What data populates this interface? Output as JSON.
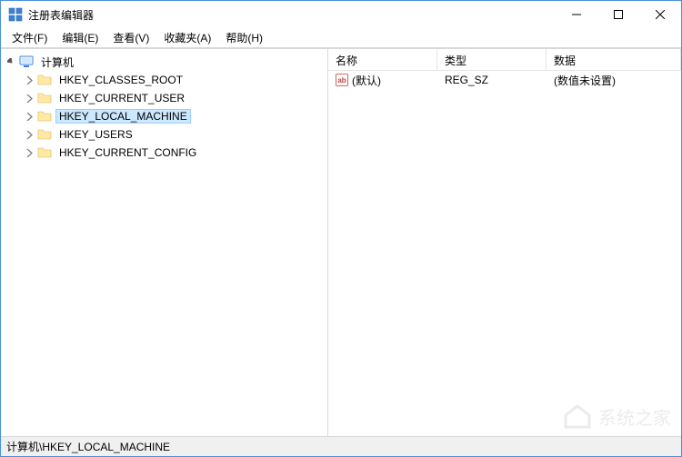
{
  "window": {
    "title": "注册表编辑器"
  },
  "menu": {
    "file": "文件(F)",
    "edit": "编辑(E)",
    "view": "查看(V)",
    "favorites": "收藏夹(A)",
    "help": "帮助(H)"
  },
  "tree": {
    "root_label": "计算机",
    "items": [
      {
        "label": "HKEY_CLASSES_ROOT"
      },
      {
        "label": "HKEY_CURRENT_USER"
      },
      {
        "label": "HKEY_LOCAL_MACHINE"
      },
      {
        "label": "HKEY_USERS"
      },
      {
        "label": "HKEY_CURRENT_CONFIG"
      }
    ],
    "selected_index": 2
  },
  "list": {
    "columns": {
      "name": "名称",
      "type": "类型",
      "data": "数据"
    },
    "rows": [
      {
        "name": "(默认)",
        "type": "REG_SZ",
        "data": "(数值未设置)"
      }
    ]
  },
  "statusbar": {
    "path": "计算机\\HKEY_LOCAL_MACHINE"
  },
  "watermark": {
    "text": "系统之家"
  }
}
